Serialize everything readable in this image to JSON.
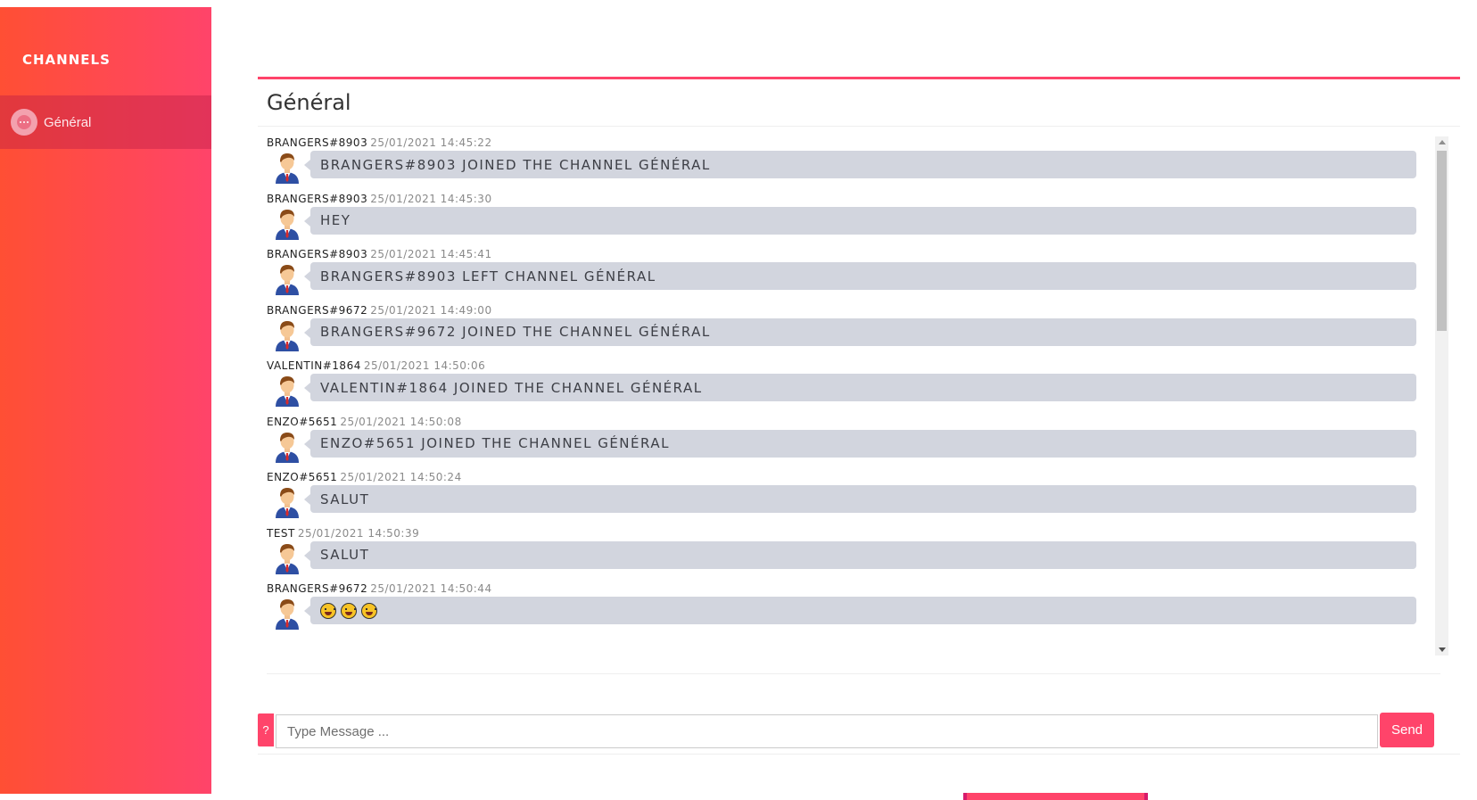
{
  "sidebar": {
    "title": "CHANNELS",
    "channels": [
      {
        "label": "Général",
        "icon": "chat-bubble-icon",
        "active": true
      }
    ]
  },
  "chat": {
    "title": "Général",
    "messages": [
      {
        "user": "BRANGERS#8903",
        "time": "25/01/2021 14:45:22",
        "text": "BRANGERS#8903 JOINED THE CHANNEL GÉNÉRAL"
      },
      {
        "user": "BRANGERS#8903",
        "time": "25/01/2021 14:45:30",
        "text": "HEY"
      },
      {
        "user": "BRANGERS#8903",
        "time": "25/01/2021 14:45:41",
        "text": "BRANGERS#8903 LEFT CHANNEL GÉNÉRAL"
      },
      {
        "user": "BRANGERS#9672",
        "time": "25/01/2021 14:49:00",
        "text": "BRANGERS#9672 JOINED THE CHANNEL GÉNÉRAL"
      },
      {
        "user": "VALENTIN#1864",
        "time": "25/01/2021 14:50:06",
        "text": "VALENTIN#1864 JOINED THE CHANNEL GÉNÉRAL"
      },
      {
        "user": "ENZO#5651",
        "time": "25/01/2021 14:50:08",
        "text": "ENZO#5651 JOINED THE CHANNEL GÉNÉRAL"
      },
      {
        "user": "ENZO#5651",
        "time": "25/01/2021 14:50:24",
        "text": "SALUT"
      },
      {
        "user": "TEST",
        "time": "25/01/2021 14:50:39",
        "text": "SALUT"
      },
      {
        "user": "BRANGERS#9672",
        "time": "25/01/2021 14:50:44",
        "text": "",
        "emoji_count": 3
      }
    ]
  },
  "composer": {
    "help_label": "?",
    "placeholder": "Type Message ...",
    "send_label": "Send"
  },
  "colors": {
    "accent": "#ff446a",
    "sidebar_start": "#ff4f34",
    "sidebar_end": "#ff446a",
    "bubble": "#d2d5de"
  }
}
